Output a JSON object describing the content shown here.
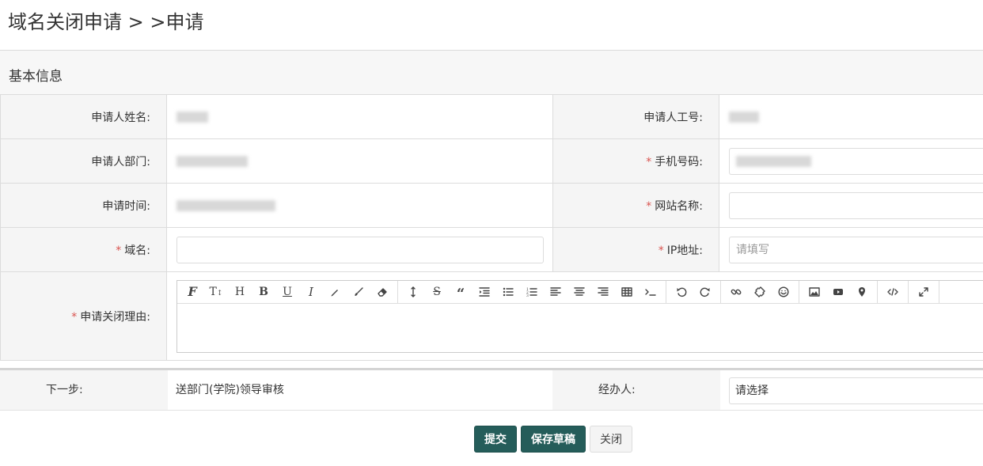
{
  "header": {
    "title": "域名关闭申请 > >申请"
  },
  "section": {
    "title": "基本信息"
  },
  "fields": {
    "applicant_name_label": "申请人姓名:",
    "applicant_id_label": "申请人工号:",
    "department_label": "申请人部门:",
    "phone_label": "手机号码:",
    "apply_time_label": "申请时间:",
    "site_name_label": "网站名称:",
    "domain_label": "域名:",
    "ip_label": "IP地址:",
    "ip_placeholder": "请填写",
    "reason_label": "申请关闭理由:",
    "required_mark": "*"
  },
  "editor": {
    "toolbar_icons": [
      [
        "font-icon",
        "text-height-icon",
        "heading-icon",
        "bold-icon",
        "underline-icon",
        "italic-icon",
        "pencil-icon",
        "brush-icon",
        "eraser-icon"
      ],
      [
        "line-height-icon",
        "strikethrough-icon",
        "quote-icon",
        "indent-icon",
        "bullet-list-icon",
        "numbered-list-icon",
        "align-left-icon",
        "align-center-icon",
        "align-right-icon",
        "table-icon",
        "code-icon"
      ],
      [
        "undo-icon",
        "redo-icon"
      ],
      [
        "link-icon",
        "unlink-icon",
        "emoji-icon"
      ],
      [
        "image-icon",
        "video-icon",
        "location-icon"
      ],
      [
        "html-icon"
      ],
      [
        "fullscreen-icon"
      ]
    ]
  },
  "next": {
    "step_label": "下一步:",
    "step_value": "送部门(学院)领导审核",
    "handler_label": "经办人:",
    "handler_value": "请选择"
  },
  "buttons": {
    "submit": "提交",
    "save_draft": "保存草稿",
    "close": "关闭"
  },
  "colors": {
    "primary": "#255d5a",
    "required": "#d9534f"
  }
}
